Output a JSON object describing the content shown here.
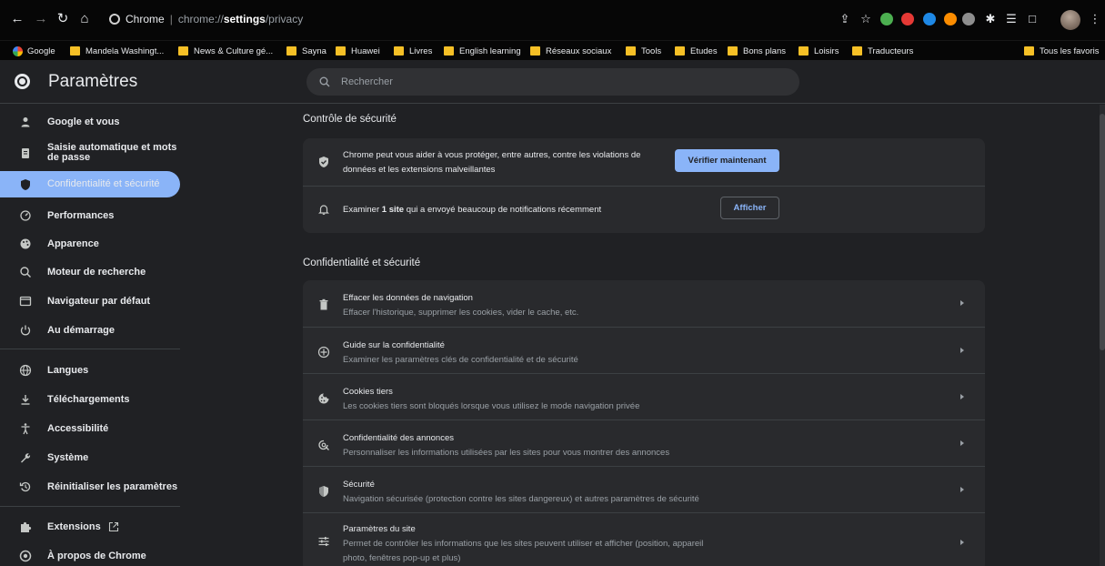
{
  "browser": {
    "site_chip": "Chrome",
    "url_scheme": "chrome://",
    "url_host": "settings",
    "url_path": "/privacy",
    "bookmarks": [
      {
        "label": "Google",
        "icon": "google-logo"
      },
      {
        "label": "Mandela Washingt...",
        "icon": "folder"
      },
      {
        "label": "News & Culture gé...",
        "icon": "folder"
      },
      {
        "label": "Sayna",
        "icon": "folder"
      },
      {
        "label": "Huawei",
        "icon": "folder"
      },
      {
        "label": "Livres",
        "icon": "folder"
      },
      {
        "label": "English learning",
        "icon": "folder"
      },
      {
        "label": "Réseaux sociaux",
        "icon": "folder"
      },
      {
        "label": "Tools",
        "icon": "folder"
      },
      {
        "label": "Etudes",
        "icon": "folder"
      },
      {
        "label": "Bons plans",
        "icon": "folder"
      },
      {
        "label": "Loisirs",
        "icon": "folder"
      },
      {
        "label": "Traducteurs",
        "icon": "folder"
      }
    ],
    "all_bookmarks": "Tous les favoris"
  },
  "header": {
    "title": "Paramètres",
    "search_placeholder": "Rechercher"
  },
  "sidebar": {
    "items": [
      {
        "label": "Google et vous",
        "icon": "person-icon"
      },
      {
        "label": "Saisie automatique et mots de passe",
        "icon": "clipboard-icon"
      },
      {
        "label": "Confidentialité et sécurité",
        "icon": "shield-icon",
        "active": true
      },
      {
        "label": "Performances",
        "icon": "speedometer-icon"
      },
      {
        "label": "Apparence",
        "icon": "palette-icon"
      },
      {
        "label": "Moteur de recherche",
        "icon": "search-icon"
      },
      {
        "label": "Navigateur par défaut",
        "icon": "browser-icon"
      },
      {
        "label": "Au démarrage",
        "icon": "power-icon"
      },
      {
        "label": "Langues",
        "icon": "globe-icon"
      },
      {
        "label": "Téléchargements",
        "icon": "download-icon"
      },
      {
        "label": "Accessibilité",
        "icon": "accessibility-icon"
      },
      {
        "label": "Système",
        "icon": "wrench-icon"
      },
      {
        "label": "Réinitialiser les paramètres",
        "icon": "restore-icon"
      },
      {
        "label": "Extensions",
        "icon": "puzzle-icon"
      },
      {
        "label": "À propos de Chrome",
        "icon": "chrome-icon"
      }
    ]
  },
  "safety_check": {
    "title": "Contrôle de sécurité",
    "row1_line1": "Chrome peut vous aider à vous protéger, entre autres, contre les violations de",
    "row1_line2": "données et les extensions malveillantes",
    "row1_button": "Vérifier maintenant",
    "row2_prefix": "Examiner ",
    "row2_bold": "1 site",
    "row2_suffix": " qui a envoyé beaucoup de notifications récemment",
    "row2_button": "Afficher"
  },
  "privacy": {
    "title": "Confidentialité et sécurité",
    "rows": [
      {
        "title": "Effacer les données de navigation",
        "desc": "Effacer l'historique, supprimer les cookies, vider le cache, etc.",
        "icon": "trash-icon"
      },
      {
        "title": "Guide sur la confidentialité",
        "desc": "Examiner les paramètres clés de confidentialité et de sécurité",
        "icon": "compass-icon"
      },
      {
        "title": "Cookies tiers",
        "desc": "Les cookies tiers sont bloqués lorsque vous utilisez le mode navigation privée",
        "icon": "cookie-icon"
      },
      {
        "title": "Confidentialité des annonces",
        "desc": "Personnaliser les informations utilisées par les sites pour vous montrer des annonces",
        "icon": "ad-privacy-icon"
      },
      {
        "title": "Sécurité",
        "desc": "Navigation sécurisée (protection contre les sites dangereux) et autres paramètres de sécurité",
        "icon": "shield-icon"
      },
      {
        "title": "Paramètres du site",
        "desc": "Permet de contrôler les informations que les sites peuvent utiliser et afficher (position, appareil",
        "desc2": "photo, fenêtres pop-up et plus)",
        "icon": "sliders-icon"
      }
    ]
  }
}
